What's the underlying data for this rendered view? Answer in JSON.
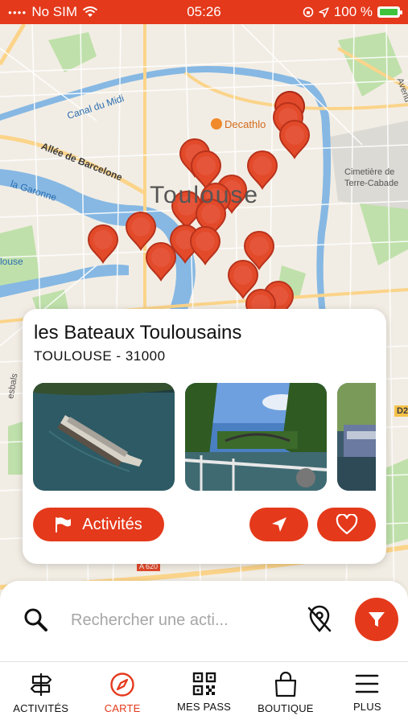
{
  "status_bar": {
    "carrier": "No SIM",
    "time": "05:26",
    "battery": "100 %"
  },
  "map": {
    "labels": {
      "canal_du_midi": "Canal du Midi",
      "allee_barcelone": "Allée de Barcelone",
      "la_garonne": "la Garonne",
      "decathlon": "Decathlo",
      "toulouse": "Toulouse",
      "cimetiere_1": "Cimetière de",
      "cimetiere_2": "Terre-Cabade",
      "louse": "louse",
      "avenue": "Avenu",
      "road_d2": "D2",
      "road_a620": "A 620",
      "esbals": "esbals"
    }
  },
  "card": {
    "title": "les Bateaux Toulousains",
    "subtitle": "TOULOUSE - 31000",
    "activities_button": "Activités"
  },
  "search": {
    "placeholder": "Rechercher une acti..."
  },
  "tabs": [
    {
      "label": "ACTIVITÉS",
      "icon": "signpost-icon"
    },
    {
      "label": "CARTE",
      "icon": "compass-icon"
    },
    {
      "label": "MES PASS",
      "icon": "qr-code-icon"
    },
    {
      "label": "BOUTIQUE",
      "icon": "shopping-bag-icon"
    },
    {
      "label": "PLUS",
      "icon": "menu-icon"
    }
  ],
  "colors": {
    "accent": "#e4391b",
    "water": "#7fb3e0",
    "park": "#b9dba5"
  }
}
